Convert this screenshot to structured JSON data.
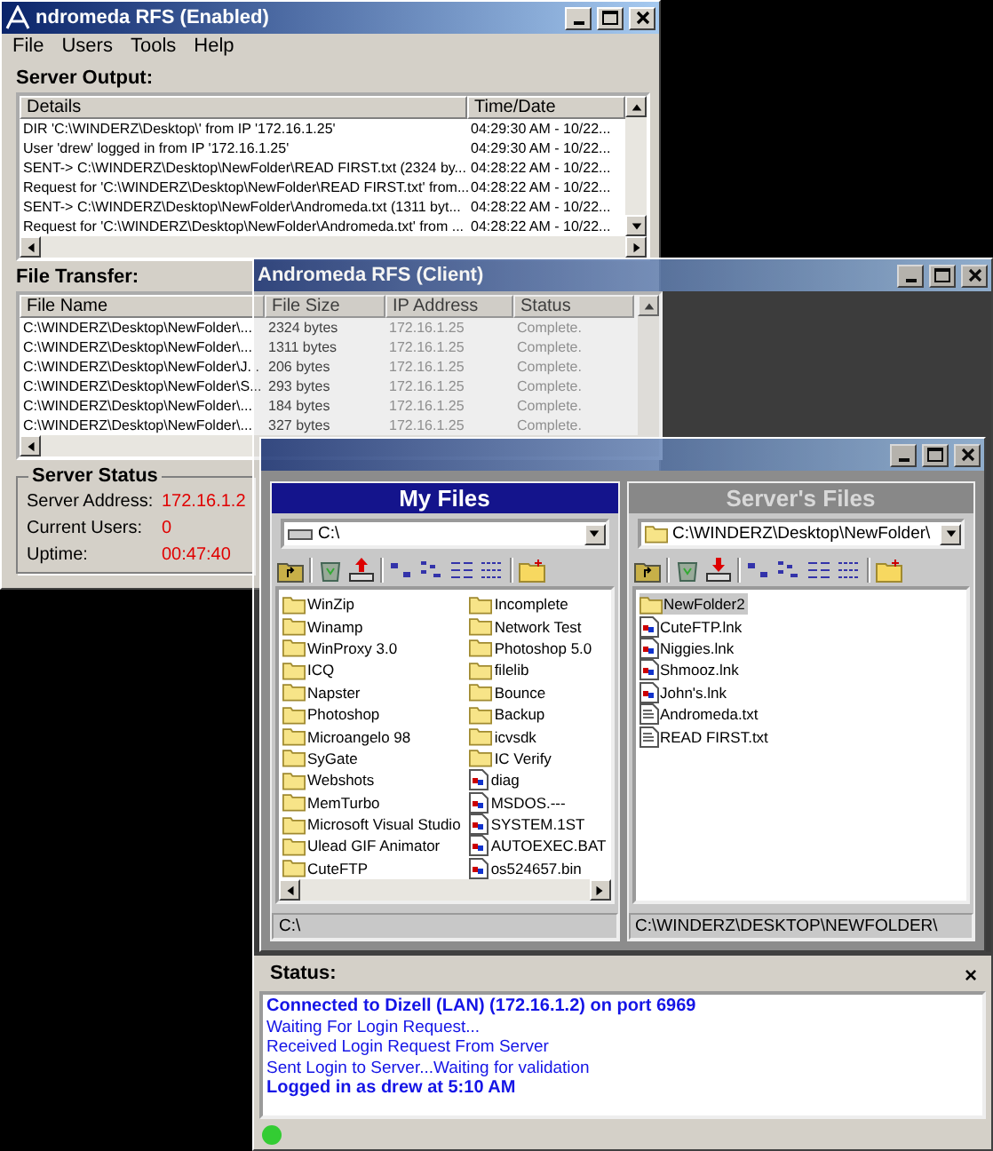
{
  "server_window": {
    "title": "ndromeda RFS (Enabled)",
    "menu": [
      "File",
      "Users",
      "Tools",
      "Help"
    ],
    "output_label": "Server Output:",
    "output_columns": [
      "Details",
      "Time/Date"
    ],
    "output_rows": [
      {
        "details": "DIR 'C:\\WINDERZ\\Desktop\\' from IP '172.16.1.25'",
        "time": "04:29:30 AM - 10/22..."
      },
      {
        "details": "User 'drew' logged in from IP '172.16.1.25'",
        "time": "04:29:30 AM - 10/22..."
      },
      {
        "details": "SENT-> C:\\WINDERZ\\Desktop\\NewFolder\\READ FIRST.txt (2324 by...",
        "time": "04:28:22 AM - 10/22..."
      },
      {
        "details": "Request for 'C:\\WINDERZ\\Desktop\\NewFolder\\READ FIRST.txt' from...",
        "time": "04:28:22 AM - 10/22..."
      },
      {
        "details": "SENT-> C:\\WINDERZ\\Desktop\\NewFolder\\Andromeda.txt (1311 byt...",
        "time": "04:28:22 AM - 10/22..."
      },
      {
        "details": "Request for 'C:\\WINDERZ\\Desktop\\NewFolder\\Andromeda.txt' from ...",
        "time": "04:28:22 AM - 10/22..."
      }
    ],
    "transfer_label": "File Transfer:",
    "transfer_columns": [
      "File Name",
      "File Size",
      "IP Address",
      "Status"
    ],
    "transfer_rows": [
      {
        "file": "C:\\WINDERZ\\Desktop\\NewFolder\\...",
        "size": "2324 bytes",
        "ip": "172.16.1.25",
        "status": "Complete."
      },
      {
        "file": "C:\\WINDERZ\\Desktop\\NewFolder\\...",
        "size": "1311 bytes",
        "ip": "172.16.1.25",
        "status": "Complete."
      },
      {
        "file": "C:\\WINDERZ\\Desktop\\NewFolder\\J...",
        "size": "206 bytes",
        "ip": "172.16.1.25",
        "status": "Complete."
      },
      {
        "file": "C:\\WINDERZ\\Desktop\\NewFolder\\S...",
        "size": "293 bytes",
        "ip": "172.16.1.25",
        "status": "Complete."
      },
      {
        "file": "C:\\WINDERZ\\Desktop\\NewFolder\\...",
        "size": "184 bytes",
        "ip": "172.16.1.25",
        "status": "Complete."
      },
      {
        "file": "C:\\WINDERZ\\Desktop\\NewFolder\\...",
        "size": "327 bytes",
        "ip": "172.16.1.25",
        "status": "Complete."
      }
    ],
    "status_group": {
      "title": "Server Status",
      "fields": [
        {
          "label": "Server Address:",
          "value": "172.16.1.2"
        },
        {
          "label": "Current Users:",
          "value": "0"
        },
        {
          "label": "Uptime:",
          "value": "00:47:40"
        }
      ]
    }
  },
  "client_window": {
    "title": "Andromeda RFS (Client)",
    "panels": [
      {
        "kind": "local",
        "title": "My Files",
        "active": true,
        "path": "C:\\",
        "status_path": "C:\\",
        "items": [
          {
            "name": "WinZip",
            "kind": "folder",
            "selected": false
          },
          {
            "name": "Winamp",
            "kind": "folder",
            "selected": false
          },
          {
            "name": "WinProxy 3.0",
            "kind": "folder",
            "selected": false
          },
          {
            "name": "ICQ",
            "kind": "folder",
            "selected": false
          },
          {
            "name": "Napster",
            "kind": "folder",
            "selected": false
          },
          {
            "name": "Photoshop",
            "kind": "folder",
            "selected": false
          },
          {
            "name": "Microangelo 98",
            "kind": "folder",
            "selected": false
          },
          {
            "name": "SyGate",
            "kind": "folder",
            "selected": false
          },
          {
            "name": "Webshots",
            "kind": "folder",
            "selected": false
          },
          {
            "name": "MemTurbo",
            "kind": "folder",
            "selected": false
          },
          {
            "name": "Microsoft Visual Studio",
            "kind": "folder",
            "selected": false
          },
          {
            "name": "Ulead GIF Animator",
            "kind": "folder",
            "selected": false
          },
          {
            "name": "CuteFTP",
            "kind": "folder",
            "selected": false
          },
          {
            "name": "Incomplete",
            "kind": "folder",
            "selected": false
          },
          {
            "name": "Network Test",
            "kind": "folder",
            "selected": false
          },
          {
            "name": "Photoshop 5.0",
            "kind": "folder",
            "selected": false
          },
          {
            "name": "filelib",
            "kind": "folder",
            "selected": false
          },
          {
            "name": "Bounce",
            "kind": "folder",
            "selected": false
          },
          {
            "name": "Backup",
            "kind": "folder",
            "selected": false
          },
          {
            "name": "icvsdk",
            "kind": "folder",
            "selected": false
          },
          {
            "name": "IC Verify",
            "kind": "folder",
            "selected": false
          },
          {
            "name": "diag",
            "kind": "program",
            "selected": false
          },
          {
            "name": "MSDOS.---",
            "kind": "program",
            "selected": false
          },
          {
            "name": "SYSTEM.1ST",
            "kind": "program",
            "selected": false
          },
          {
            "name": "AUTOEXEC.BAT",
            "kind": "program",
            "selected": false
          },
          {
            "name": "os524657.bin",
            "kind": "program",
            "selected": false
          }
        ]
      },
      {
        "kind": "remote",
        "title": "Server's Files",
        "active": false,
        "path": "C:\\WINDERZ\\Desktop\\NewFolder\\",
        "status_path": "C:\\WINDERZ\\DESKTOP\\NEWFOLDER\\",
        "items": [
          {
            "name": "NewFolder2",
            "kind": "folder",
            "selected": true
          },
          {
            "name": "CuteFTP.lnk",
            "kind": "program",
            "selected": false
          },
          {
            "name": "Niggies.lnk",
            "kind": "program",
            "selected": false
          },
          {
            "name": "Shmooz.lnk",
            "kind": "program",
            "selected": false
          },
          {
            "name": "John's.lnk",
            "kind": "program",
            "selected": false
          },
          {
            "name": "Andromeda.txt",
            "kind": "text",
            "selected": false
          },
          {
            "name": "READ FIRST.txt",
            "kind": "text",
            "selected": false
          }
        ]
      }
    ],
    "status": {
      "label": "Status:",
      "close": "×",
      "connected": true,
      "lines": [
        {
          "text": "Connected to Dizell (LAN) (172.16.1.2) on port 6969",
          "bold": true
        },
        {
          "text": "Waiting For Login Request...",
          "bold": false
        },
        {
          "text": "Received Login Request From Server",
          "bold": false
        },
        {
          "text": "Sent Login to Server...Waiting for validation",
          "bold": false
        },
        {
          "text": "Logged in as drew at 5:10 AM",
          "bold": true
        }
      ]
    }
  }
}
